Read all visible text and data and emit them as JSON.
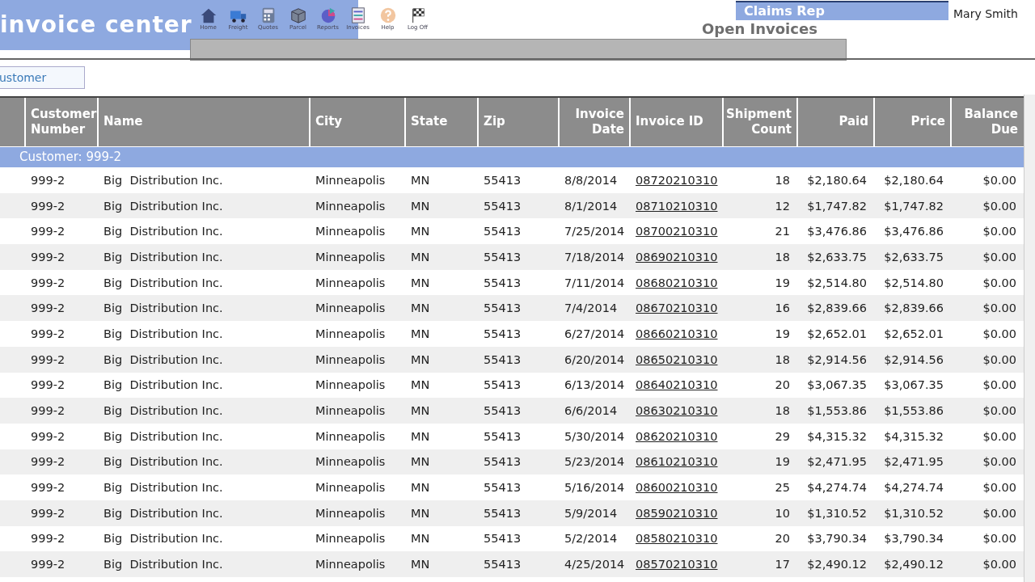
{
  "header": {
    "title": "invoice center",
    "nav": [
      {
        "label": "Home"
      },
      {
        "label": "Freight"
      },
      {
        "label": "Quotes"
      },
      {
        "label": "Parcel"
      },
      {
        "label": "Reports"
      },
      {
        "label": "Invoices"
      },
      {
        "label": "Help"
      },
      {
        "label": "Log Off"
      }
    ],
    "rep_label": "Claims Rep",
    "rep_name": "Mary Smith",
    "page_title": "Open Invoices"
  },
  "customer_field": {
    "value": "ustomer"
  },
  "table": {
    "columns": [
      "Customer Number",
      "Name",
      "City",
      "State",
      "Zip",
      "Invoice Date",
      "Invoice ID",
      "Shipment Count",
      "Paid",
      "Price",
      "Balance Due"
    ],
    "group": "Customer: 999-2",
    "rows": [
      [
        "999-2",
        "Big  Distribution Inc.",
        "Minneapolis",
        "MN",
        "55413",
        "8/8/2014",
        "08720210310",
        "18",
        "$2,180.64",
        "$2,180.64",
        "$0.00"
      ],
      [
        "999-2",
        "Big  Distribution Inc.",
        "Minneapolis",
        "MN",
        "55413",
        "8/1/2014",
        "08710210310",
        "12",
        "$1,747.82",
        "$1,747.82",
        "$0.00"
      ],
      [
        "999-2",
        "Big  Distribution Inc.",
        "Minneapolis",
        "MN",
        "55413",
        "7/25/2014",
        "08700210310",
        "21",
        "$3,476.86",
        "$3,476.86",
        "$0.00"
      ],
      [
        "999-2",
        "Big  Distribution Inc.",
        "Minneapolis",
        "MN",
        "55413",
        "7/18/2014",
        "08690210310",
        "18",
        "$2,633.75",
        "$2,633.75",
        "$0.00"
      ],
      [
        "999-2",
        "Big  Distribution Inc.",
        "Minneapolis",
        "MN",
        "55413",
        "7/11/2014",
        "08680210310",
        "19",
        "$2,514.80",
        "$2,514.80",
        "$0.00"
      ],
      [
        "999-2",
        "Big  Distribution Inc.",
        "Minneapolis",
        "MN",
        "55413",
        "7/4/2014",
        "08670210310",
        "16",
        "$2,839.66",
        "$2,839.66",
        "$0.00"
      ],
      [
        "999-2",
        "Big  Distribution Inc.",
        "Minneapolis",
        "MN",
        "55413",
        "6/27/2014",
        "08660210310",
        "19",
        "$2,652.01",
        "$2,652.01",
        "$0.00"
      ],
      [
        "999-2",
        "Big  Distribution Inc.",
        "Minneapolis",
        "MN",
        "55413",
        "6/20/2014",
        "08650210310",
        "18",
        "$2,914.56",
        "$2,914.56",
        "$0.00"
      ],
      [
        "999-2",
        "Big  Distribution Inc.",
        "Minneapolis",
        "MN",
        "55413",
        "6/13/2014",
        "08640210310",
        "20",
        "$3,067.35",
        "$3,067.35",
        "$0.00"
      ],
      [
        "999-2",
        "Big  Distribution Inc.",
        "Minneapolis",
        "MN",
        "55413",
        "6/6/2014",
        "08630210310",
        "18",
        "$1,553.86",
        "$1,553.86",
        "$0.00"
      ],
      [
        "999-2",
        "Big  Distribution Inc.",
        "Minneapolis",
        "MN",
        "55413",
        "5/30/2014",
        "08620210310",
        "29",
        "$4,315.32",
        "$4,315.32",
        "$0.00"
      ],
      [
        "999-2",
        "Big  Distribution Inc.",
        "Minneapolis",
        "MN",
        "55413",
        "5/23/2014",
        "08610210310",
        "19",
        "$2,471.95",
        "$2,471.95",
        "$0.00"
      ],
      [
        "999-2",
        "Big  Distribution Inc.",
        "Minneapolis",
        "MN",
        "55413",
        "5/16/2014",
        "08600210310",
        "25",
        "$4,274.74",
        "$4,274.74",
        "$0.00"
      ],
      [
        "999-2",
        "Big  Distribution Inc.",
        "Minneapolis",
        "MN",
        "55413",
        "5/9/2014",
        "08590210310",
        "10",
        "$1,310.52",
        "$1,310.52",
        "$0.00"
      ],
      [
        "999-2",
        "Big  Distribution Inc.",
        "Minneapolis",
        "MN",
        "55413",
        "5/2/2014",
        "08580210310",
        "20",
        "$3,790.34",
        "$3,790.34",
        "$0.00"
      ],
      [
        "999-2",
        "Big  Distribution Inc.",
        "Minneapolis",
        "MN",
        "55413",
        "4/25/2014",
        "08570210310",
        "17",
        "$2,490.12",
        "$2,490.12",
        "$0.00"
      ]
    ]
  }
}
